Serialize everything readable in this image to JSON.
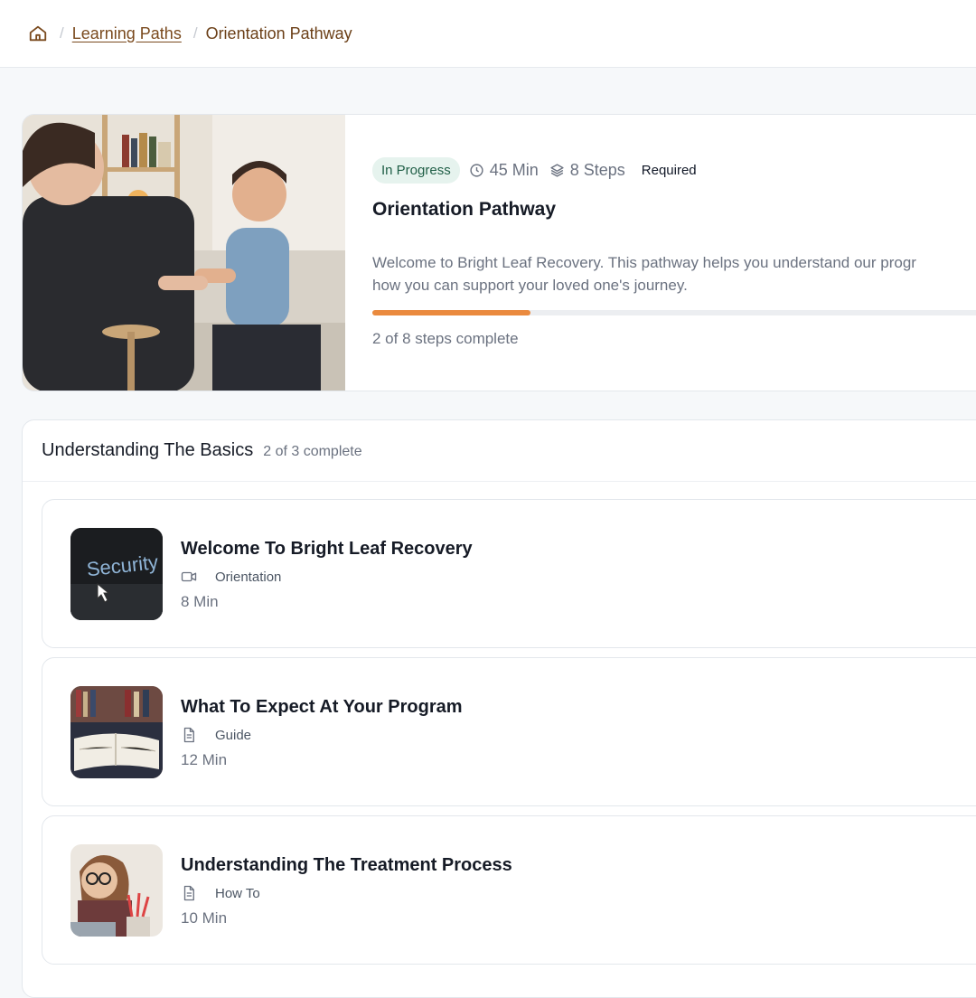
{
  "breadcrumb": {
    "home_icon": "home-icon",
    "separator": "/",
    "items": [
      "Learning Paths",
      "Orientation Pathway"
    ]
  },
  "hero": {
    "status": "In Progress",
    "duration": "45 Min",
    "steps": "8 Steps",
    "requirement": "Required",
    "title": "Orientation Pathway",
    "description_line1": "Welcome to Bright Leaf Recovery. This pathway helps you understand our progr",
    "description_line2": "how you can support your loved one's journey.",
    "progress_fraction": 0.25,
    "progress_text": "2 of 8 steps complete",
    "colors": {
      "accent": "#ea8a3e",
      "status_bg": "#e6f3ee",
      "status_text": "#1f5e46"
    }
  },
  "section": {
    "title": "Understanding The Basics",
    "count": "2 of 3 complete",
    "lessons": [
      {
        "title": "Welcome To Bright Leaf Recovery",
        "type": "Orientation",
        "type_icon": "video-icon",
        "duration": "8 Min",
        "thumb_text": "Security"
      },
      {
        "title": "What To Expect At Your Program",
        "type": "Guide",
        "type_icon": "document-icon",
        "duration": "12 Min"
      },
      {
        "title": "Understanding The Treatment Process",
        "type": "How To",
        "type_icon": "document-icon",
        "duration": "10 Min"
      }
    ]
  }
}
